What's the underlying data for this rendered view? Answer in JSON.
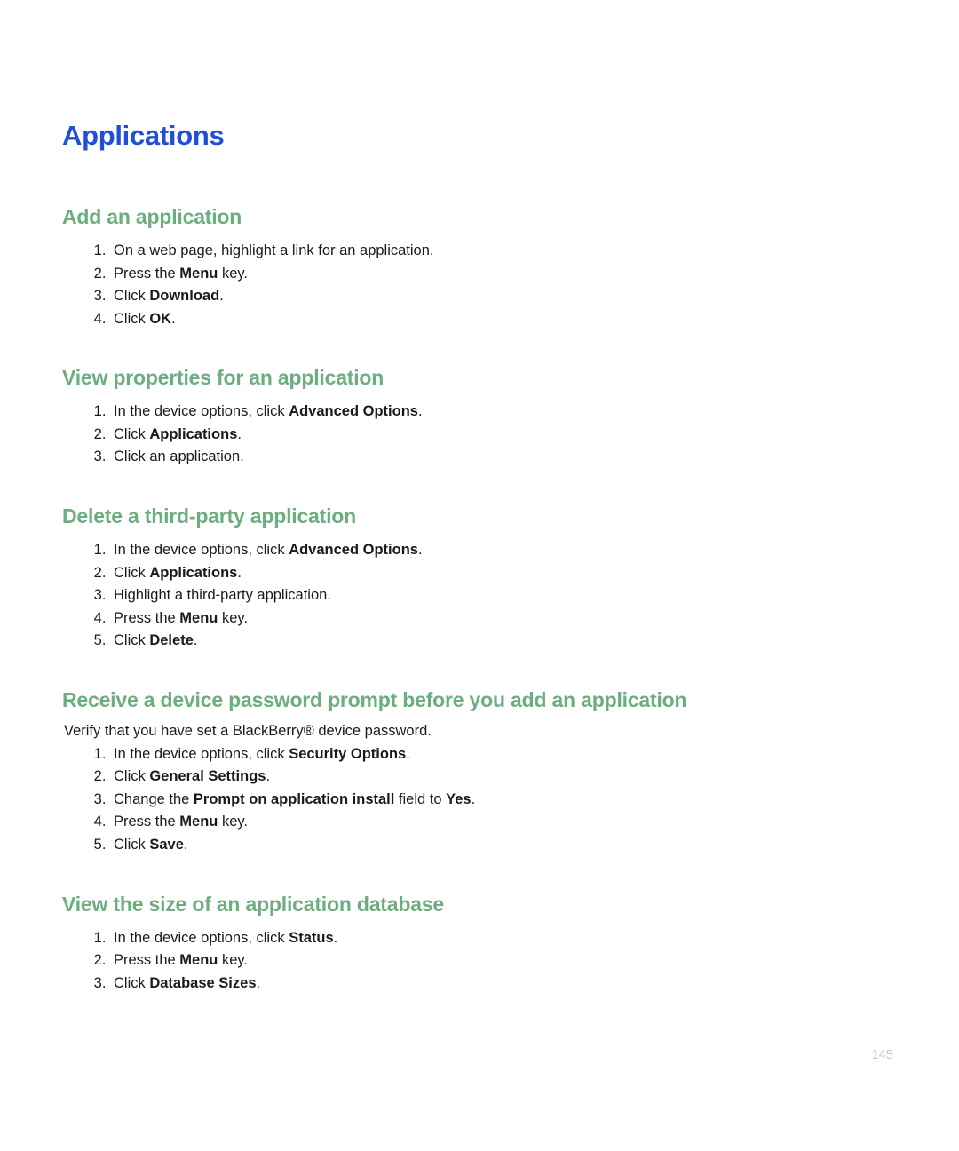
{
  "title": "Applications",
  "page_number": "145",
  "sections": [
    {
      "heading": "Add an application",
      "steps": [
        [
          {
            "t": "On a web page, highlight a link for an application."
          }
        ],
        [
          {
            "t": "Press the "
          },
          {
            "t": "Menu",
            "b": true
          },
          {
            "t": " key."
          }
        ],
        [
          {
            "t": "Click "
          },
          {
            "t": "Download",
            "b": true
          },
          {
            "t": "."
          }
        ],
        [
          {
            "t": "Click "
          },
          {
            "t": "OK",
            "b": true
          },
          {
            "t": "."
          }
        ]
      ]
    },
    {
      "heading": "View properties for an application",
      "steps": [
        [
          {
            "t": "In the device options, click "
          },
          {
            "t": "Advanced Options",
            "b": true
          },
          {
            "t": "."
          }
        ],
        [
          {
            "t": "Click "
          },
          {
            "t": "Applications",
            "b": true
          },
          {
            "t": "."
          }
        ],
        [
          {
            "t": "Click an application."
          }
        ]
      ]
    },
    {
      "heading": "Delete a third-party application",
      "steps": [
        [
          {
            "t": "In the device options, click "
          },
          {
            "t": "Advanced Options",
            "b": true
          },
          {
            "t": "."
          }
        ],
        [
          {
            "t": "Click "
          },
          {
            "t": "Applications",
            "b": true
          },
          {
            "t": "."
          }
        ],
        [
          {
            "t": "Highlight a third-party application."
          }
        ],
        [
          {
            "t": "Press the "
          },
          {
            "t": "Menu",
            "b": true
          },
          {
            "t": " key."
          }
        ],
        [
          {
            "t": "Click "
          },
          {
            "t": "Delete",
            "b": true
          },
          {
            "t": "."
          }
        ]
      ]
    },
    {
      "heading": "Receive a device password prompt before you add an application",
      "note": "Verify that you have set a BlackBerry® device password.",
      "steps": [
        [
          {
            "t": "In the device options, click "
          },
          {
            "t": "Security Options",
            "b": true
          },
          {
            "t": "."
          }
        ],
        [
          {
            "t": "Click "
          },
          {
            "t": "General Settings",
            "b": true
          },
          {
            "t": "."
          }
        ],
        [
          {
            "t": "Change the "
          },
          {
            "t": "Prompt on application install",
            "b": true
          },
          {
            "t": " field to "
          },
          {
            "t": "Yes",
            "b": true
          },
          {
            "t": "."
          }
        ],
        [
          {
            "t": "Press the "
          },
          {
            "t": "Menu",
            "b": true
          },
          {
            "t": " key."
          }
        ],
        [
          {
            "t": "Click "
          },
          {
            "t": "Save",
            "b": true
          },
          {
            "t": "."
          }
        ]
      ]
    },
    {
      "heading": "View the size of an application database",
      "steps": [
        [
          {
            "t": "In the device options, click "
          },
          {
            "t": "Status",
            "b": true
          },
          {
            "t": "."
          }
        ],
        [
          {
            "t": "Press the "
          },
          {
            "t": "Menu",
            "b": true
          },
          {
            "t": " key."
          }
        ],
        [
          {
            "t": "Click "
          },
          {
            "t": "Database Sizes",
            "b": true
          },
          {
            "t": "."
          }
        ]
      ]
    }
  ]
}
